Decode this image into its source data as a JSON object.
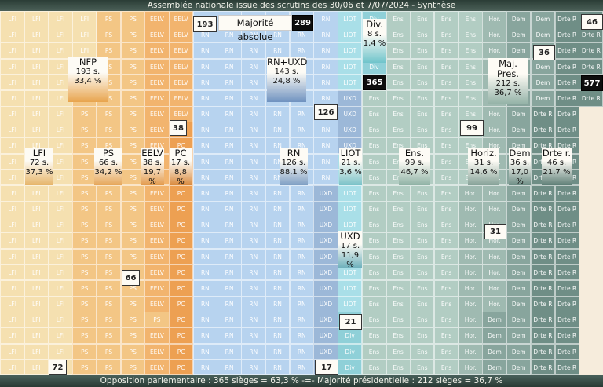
{
  "title": "Assemblée nationale issue des scrutins des 30/06 et 7/07/2024 - Synthèse",
  "footer": {
    "opposition": "Opposition parlementaire : 365 sièges = 63,3 %",
    "separator": "-=-",
    "majority": "Majorité présidentielle : 212 sièges = 36,7 %"
  },
  "majorite_absolue": {
    "label": "Majorité absolue",
    "value": "289"
  },
  "colors": {
    "LFI": "#f5e0b0",
    "PS": "#f3c685",
    "EELV": "#f2b46e",
    "PC": "#eda052",
    "RN": "#b7d3ef",
    "UXD": "#9cb8d8",
    "LIOT": "#a9dfe8",
    "Div": "#8fd0d8",
    "Ens": "#b2cdc3",
    "Hor.": "#9fbab1",
    "Dem": "#88a59d",
    "Drte R": "#6f8e86"
  },
  "chart_data": {
    "type": "seat-grid",
    "total_seats": 577,
    "groups": [
      {
        "code": "LFI",
        "name": "LFI",
        "seats": 72,
        "pct": "37,3 %"
      },
      {
        "code": "PS",
        "name": "PS",
        "seats": 66,
        "pct": "34,2 %"
      },
      {
        "code": "EELV",
        "name": "EELV",
        "seats": 38,
        "pct": "19,7 %"
      },
      {
        "code": "PC",
        "name": "PC",
        "seats": 17,
        "pct": "8,8 %"
      },
      {
        "code": "RN",
        "name": "RN",
        "seats": 126,
        "pct": "88,1 %"
      },
      {
        "code": "UXD",
        "name": "UXD",
        "seats": 17,
        "pct": "11,9 %"
      },
      {
        "code": "LIOT",
        "name": "LIOT",
        "seats": 21,
        "pct": "3,6 %"
      },
      {
        "code": "Div",
        "name": "Div.",
        "seats": 8,
        "pct": "1,4 %"
      },
      {
        "code": "Ens",
        "name": "Ens.",
        "seats": 99,
        "pct": "46,7 %"
      },
      {
        "code": "Hor.",
        "name": "Horiz.",
        "seats": 31,
        "pct": "14,6 %"
      },
      {
        "code": "Dem",
        "name": "Dem",
        "seats": 36,
        "pct": "17,0 %"
      },
      {
        "code": "Drte R",
        "name": "Drte r.",
        "seats": 46,
        "pct": "21,7 %"
      }
    ],
    "blocs": [
      {
        "name": "NFP",
        "seats": 193,
        "pct": "33,4 %"
      },
      {
        "name": "RN+UXD",
        "seats": 143,
        "pct": "24,8 %"
      },
      {
        "name": "Maj. Pres.",
        "seats": 212,
        "pct": "36,7 %"
      }
    ],
    "cumulative_markers": [
      "72",
      "66",
      "38",
      "193",
      "126",
      "17",
      "21",
      "365",
      "99",
      "31",
      "36",
      "46",
      "577"
    ]
  }
}
